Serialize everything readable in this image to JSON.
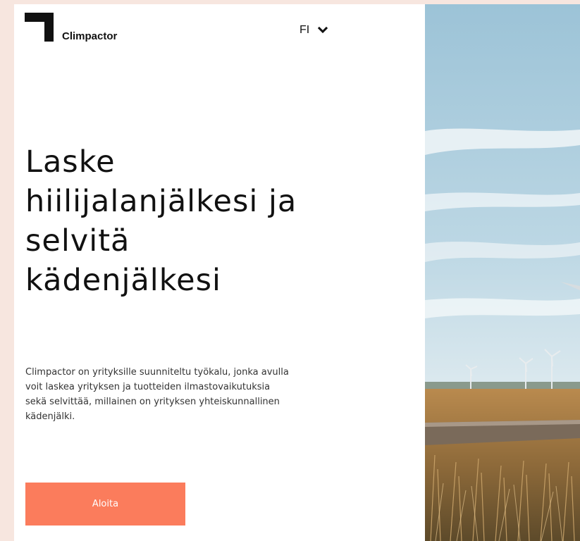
{
  "brand": {
    "name": "Climpactor"
  },
  "language": {
    "selected": "FI"
  },
  "hero": {
    "headline_lines": [
      "Laske",
      "hiilijalanjälkesi ja",
      "selvitä",
      "kädenjälkesi"
    ],
    "description_lines": [
      "Climpactor on yrityksille suunniteltu työkalu, jonka avulla",
      "voit laskea yrityksen ja tuotteiden ilmastovaikutuksia",
      "sekä selvittää, millainen on yrityksen yhteiskunnallinen",
      "kädenjälki."
    ],
    "cta_label": "Aloita"
  },
  "colors": {
    "page_background": "#f7e6df",
    "accent": "#fb7c5c",
    "text": "#111111"
  },
  "icons": {
    "logo": "climpactor-corner-mark",
    "language_toggle": "chevron-down-icon"
  }
}
